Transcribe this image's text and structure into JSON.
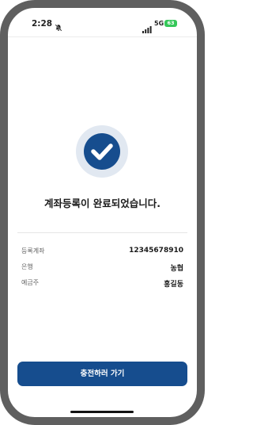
{
  "status_bar": {
    "time": "2:28",
    "network": "5G",
    "battery": "63"
  },
  "result": {
    "message": "계좌등록이 완료되었습니다."
  },
  "account_details": [
    {
      "label": "등록계좌",
      "value": "12345678910"
    },
    {
      "label": "은행",
      "value": "농협"
    },
    {
      "label": "예금주",
      "value": "홍길동"
    }
  ],
  "cta": {
    "label": "충전하러 가기"
  },
  "colors": {
    "primary": "#164d8e",
    "check_bg": "#e1e8f1",
    "battery": "#35c759",
    "frame": "#5f5f5f"
  }
}
